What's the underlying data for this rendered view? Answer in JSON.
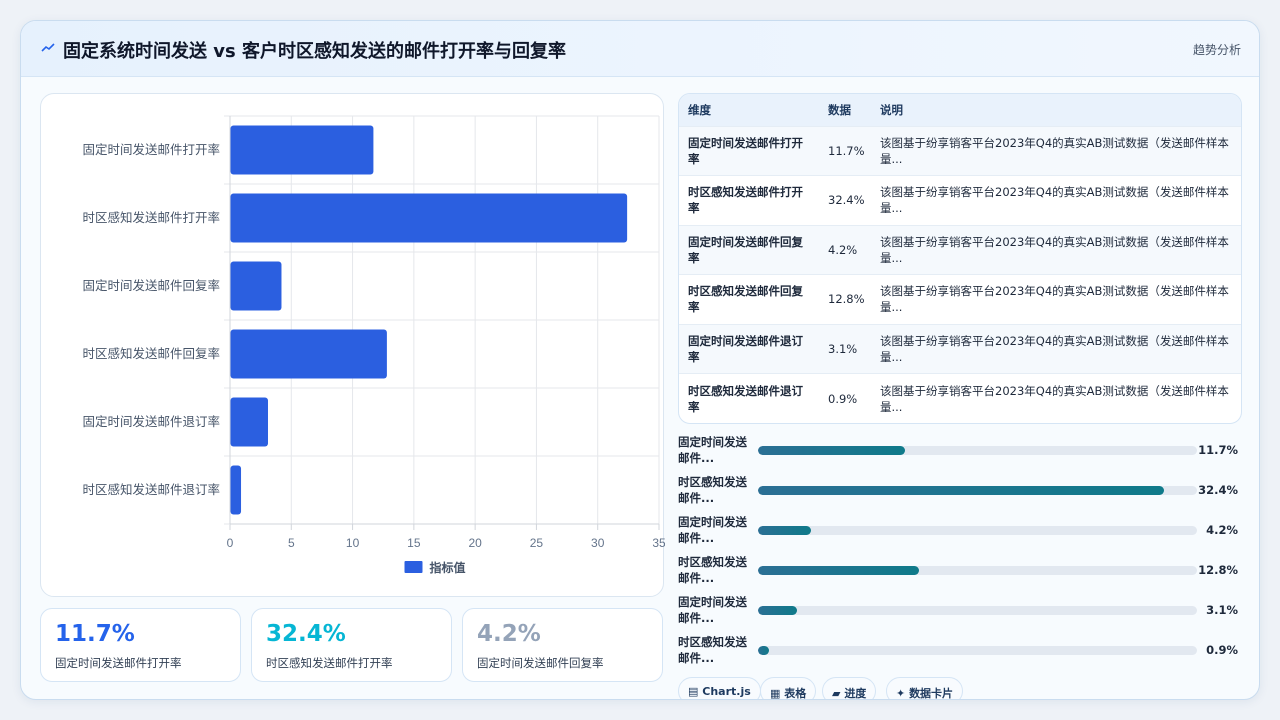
{
  "header": {
    "title": "固定系统时间发送 vs 客户时区感知发送的邮件打开率与回复率",
    "tag": "趋势分析"
  },
  "chart_data": {
    "type": "bar",
    "orientation": "horizontal",
    "categories": [
      "固定时间发送邮件打开率",
      "时区感知发送邮件打开率",
      "固定时间发送邮件回复率",
      "时区感知发送邮件回复率",
      "固定时间发送邮件退订率",
      "时区感知发送邮件退订率"
    ],
    "series": [
      {
        "name": "指标值",
        "values": [
          11.7,
          32.4,
          4.2,
          12.8,
          3.1,
          0.9
        ],
        "color": "#2b5fe0"
      }
    ],
    "xlim": [
      0,
      35
    ],
    "xticks": [
      0,
      5,
      10,
      15,
      20,
      25,
      30,
      35
    ],
    "grid": true,
    "legend": "bottom"
  },
  "kpis": [
    {
      "value": "11.7%",
      "label": "固定时间发送邮件打开率",
      "color": "#2563eb"
    },
    {
      "value": "32.4%",
      "label": "时区感知发送邮件打开率",
      "color": "#06b6d4"
    },
    {
      "value": "4.2%",
      "label": "固定时间发送邮件回复率",
      "color": "#94a3b8"
    }
  ],
  "table": {
    "headers": [
      "维度",
      "数据",
      "说明"
    ],
    "rows": [
      [
        "固定时间发送邮件打开率",
        "11.7%",
        "该图基于纷享销客平台2023年Q4的真实AB测试数据（发送邮件样本量..."
      ],
      [
        "时区感知发送邮件打开率",
        "32.4%",
        "该图基于纷享销客平台2023年Q4的真实AB测试数据（发送邮件样本量..."
      ],
      [
        "固定时间发送邮件回复率",
        "4.2%",
        "该图基于纷享销客平台2023年Q4的真实AB测试数据（发送邮件样本量..."
      ],
      [
        "时区感知发送邮件回复率",
        "12.8%",
        "该图基于纷享销客平台2023年Q4的真实AB测试数据（发送邮件样本量..."
      ],
      [
        "固定时间发送邮件退订率",
        "3.1%",
        "该图基于纷享销客平台2023年Q4的真实AB测试数据（发送邮件样本量..."
      ],
      [
        "时区感知发送邮件退订率",
        "0.9%",
        "该图基于纷享销客平台2023年Q4的真实AB测试数据（发送邮件样本量..."
      ]
    ]
  },
  "progress": [
    {
      "label": "固定时间发送邮件...",
      "value": "11.7%",
      "level": 11.7
    },
    {
      "label": "时区感知发送邮件...",
      "value": "32.4%",
      "level": 32.4
    },
    {
      "label": "固定时间发送邮件...",
      "value": "4.2%",
      "level": 4.2
    },
    {
      "label": "时区感知发送邮件...",
      "value": "12.8%",
      "level": 12.8
    },
    {
      "label": "固定时间发送邮件...",
      "value": "3.1%",
      "level": 3.1
    },
    {
      "label": "时区感知发送邮件...",
      "value": "0.9%",
      "level": 0.9
    }
  ],
  "pills": [
    {
      "icon": "▤",
      "label": "Chart.js"
    },
    {
      "icon": "▦",
      "label": "表格"
    },
    {
      "icon": "▰",
      "label": "进度"
    },
    {
      "icon": "✦",
      "label": "数据卡片"
    }
  ]
}
